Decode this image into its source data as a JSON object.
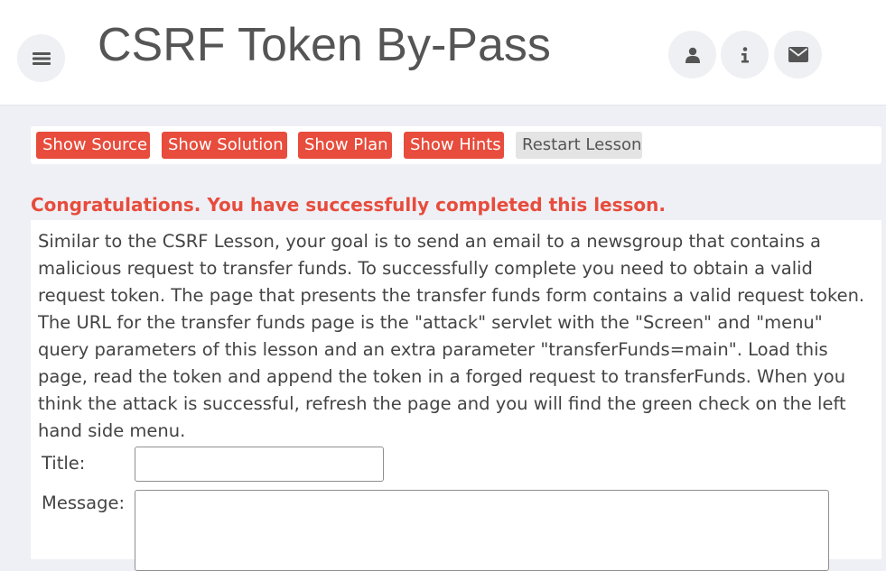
{
  "header": {
    "title": "CSRF Token By-Pass",
    "menu_icon": "hamburger-menu-icon",
    "user_icon": "user-icon",
    "info_icon": "info-icon",
    "mail_icon": "envelope-icon"
  },
  "toolbar": {
    "show_source": "Show Source",
    "show_solution": "Show Solution",
    "show_plan": "Show Plan",
    "show_hints": "Show Hints",
    "restart_lesson": "Restart Lesson"
  },
  "feedback": {
    "message": "Congratulations. You have successfully completed this lesson."
  },
  "lesson": {
    "description": "Similar to the CSRF Lesson, your goal is to send an email to a newsgroup that contains a malicious request to transfer funds. To successfully complete you need to obtain a valid request token. The page that presents the transfer funds form contains a valid request token. The URL for the transfer funds page is the \"attack\" servlet with the \"Screen\" and \"menu\" query parameters of this lesson and an extra parameter \"transferFunds=main\". Load this page, read the token and append the token in a forged request to transferFunds. When you think the attack is successful, refresh the page and you will find the green check on the left hand side menu.",
    "form": {
      "title_label": "Title:",
      "title_value": "",
      "message_label": "Message:",
      "message_value": ""
    }
  },
  "colors": {
    "accent_red": "#e74c3c",
    "page_background": "#eff0f5",
    "text": "#555555"
  }
}
